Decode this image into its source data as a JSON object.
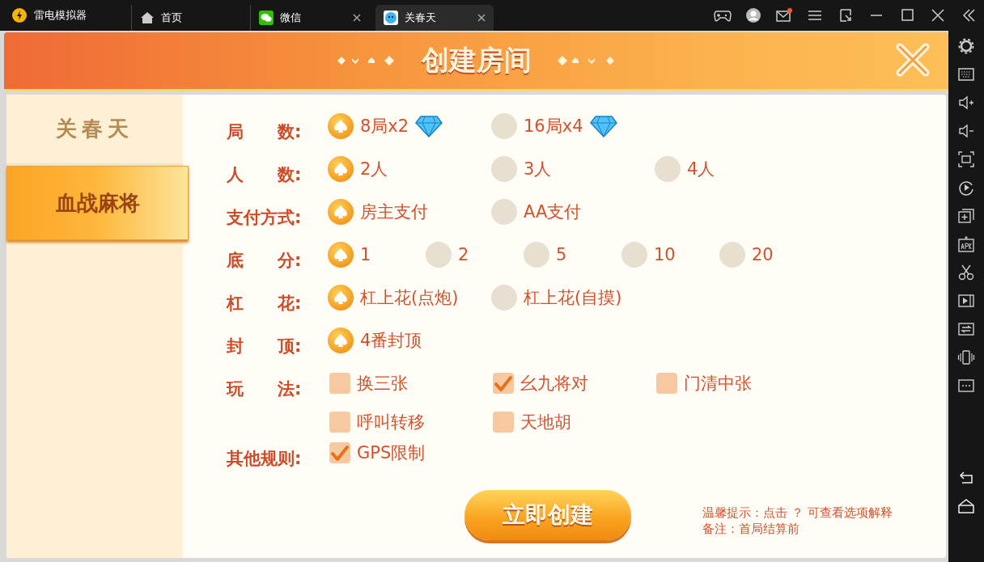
{
  "titlebar": {
    "app_name": "雷电模拟器",
    "tabs": [
      {
        "label": "首页",
        "closable": false,
        "selected": false
      },
      {
        "label": "微信",
        "closable": true,
        "selected": false
      },
      {
        "label": "关春天",
        "closable": true,
        "selected": true
      }
    ],
    "mail_unread": true
  },
  "dialog": {
    "title": "创建房间",
    "games": [
      {
        "label": "关春天",
        "selected": false
      },
      {
        "label": "血战麻将",
        "selected": true
      }
    ],
    "rules": [
      {
        "label": "局　　数:",
        "kind": "radio",
        "options": [
          {
            "text": "8局x2",
            "selected": true,
            "gem": true
          },
          {
            "text": "16局x4",
            "selected": false,
            "gem": true
          }
        ]
      },
      {
        "label": "人　　数:",
        "kind": "radio",
        "options": [
          {
            "text": "2人",
            "selected": true
          },
          {
            "text": "3人",
            "selected": false
          },
          {
            "text": "4人",
            "selected": false
          }
        ]
      },
      {
        "label": "支付方式:",
        "kind": "radio",
        "options": [
          {
            "text": "房主支付",
            "selected": true
          },
          {
            "text": "AA支付",
            "selected": false
          }
        ]
      },
      {
        "label": "底　　分:",
        "kind": "radio",
        "options": [
          {
            "text": "1",
            "selected": true
          },
          {
            "text": "2",
            "selected": false
          },
          {
            "text": "5",
            "selected": false
          },
          {
            "text": "10",
            "selected": false
          },
          {
            "text": "20",
            "selected": false
          }
        ]
      },
      {
        "label": "杠　　花:",
        "kind": "radio",
        "options": [
          {
            "text": "杠上花(点炮)",
            "selected": true
          },
          {
            "text": "杠上花(自摸)",
            "selected": false
          }
        ]
      },
      {
        "label": "封　　顶:",
        "kind": "radio",
        "options": [
          {
            "text": "4番封顶",
            "selected": true
          }
        ]
      },
      {
        "label": "玩　　法:",
        "kind": "checkbox",
        "options": [
          {
            "text": "换三张",
            "checked": false
          },
          {
            "text": "幺九将对",
            "checked": true
          },
          {
            "text": "门清中张",
            "checked": false
          },
          {
            "text": "呼叫转移",
            "checked": false
          },
          {
            "text": "天地胡",
            "checked": false
          }
        ]
      },
      {
        "label": "其他规则:",
        "kind": "checkbox",
        "options": [
          {
            "text": "GPS限制",
            "checked": true
          }
        ]
      }
    ],
    "create_button": "立即创建",
    "notes": [
      "温馨提示：点击 ？ 可查看选项解释",
      "备注：首局结算前"
    ]
  }
}
